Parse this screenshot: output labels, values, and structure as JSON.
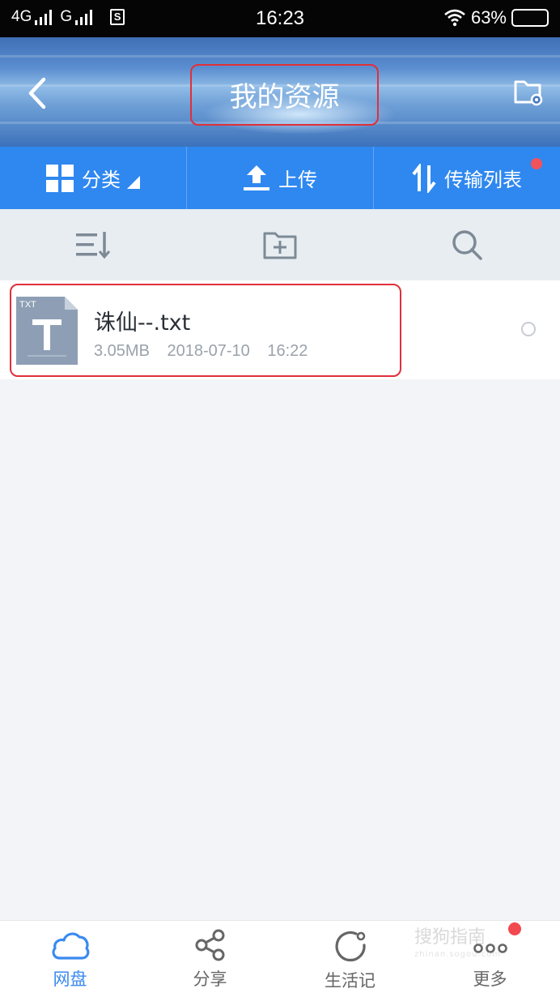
{
  "status_bar": {
    "network1": "4G",
    "network2": "G",
    "time": "16:23",
    "battery": "63%"
  },
  "header": {
    "title": "我的资源"
  },
  "toolbar": {
    "category_label": "分类",
    "upload_label": "上传",
    "transfer_label": "传输列表"
  },
  "files": [
    {
      "icon_label": "TXT",
      "name": "诛仙--.txt",
      "size": "3.05MB",
      "date": "2018-07-10",
      "time": "16:22"
    }
  ],
  "bottom_nav": {
    "items": [
      {
        "label": "网盘",
        "icon": "cloud-icon"
      },
      {
        "label": "分享",
        "icon": "share-icon"
      },
      {
        "label": "生活记",
        "icon": "life-icon"
      },
      {
        "label": "更多",
        "icon": "more-icon"
      }
    ]
  },
  "watermark": {
    "text": "搜狗指南",
    "sub": "zhinan.sogou.com"
  },
  "colors": {
    "accent": "#2f88f0",
    "highlight_border": "#e0303a",
    "badge": "#f2525a"
  }
}
